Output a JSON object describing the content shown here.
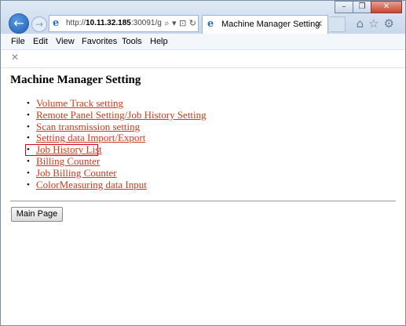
{
  "browser": {
    "address_prefix": "http://",
    "address_host": "10.11.32.185",
    "address_rest": ":30091/g",
    "address_tools": "⌕ ▾ ⊡ ↻",
    "tab_title": "Machine Manager Setting",
    "tab_close": "✕",
    "back": "←",
    "forward": "→",
    "win_min": "–",
    "win_max": "❐",
    "win_close": "✕",
    "nav_icons": "⌂☆⚙"
  },
  "menu": {
    "items": [
      "File",
      "Edit",
      "View",
      "Favorites",
      "Tools",
      "Help"
    ]
  },
  "toolbar_close": "✕",
  "page": {
    "title": "Machine Manager Setting",
    "links": [
      "Volume Track setting",
      "Remote Panel Setting/Job History Setting",
      "Scan transmission setting",
      "Setting data Import/Export",
      "Job History List",
      "Billing Counter",
      "Job Billing Counter",
      "ColorMeasuring data Input"
    ],
    "main_button": "Main Page"
  },
  "colors": {
    "link": "#d03a1a",
    "highlight_box": "#d0021b"
  }
}
